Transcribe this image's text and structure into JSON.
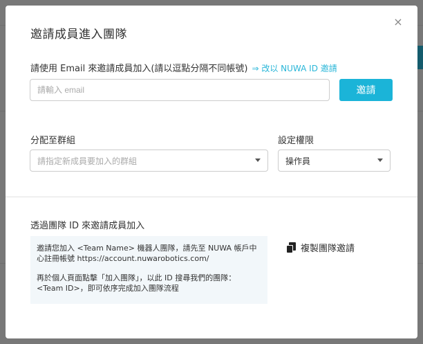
{
  "modal": {
    "title": "邀請成員進入團隊",
    "close_label": "×"
  },
  "email_section": {
    "label": "請使用 Email 來邀請成員加入(請以逗點分隔不同帳號)",
    "switch_link": "⇒ 改以 NUWA ID 邀請",
    "input_value": "",
    "input_placeholder": "請輸入 email",
    "invite_button": "邀請"
  },
  "group_section": {
    "label": "分配至群組",
    "placeholder": "請指定新成員要加入的群組"
  },
  "permission_section": {
    "label": "設定權限",
    "selected": "操作員"
  },
  "team_id_section": {
    "label": "透過團隊 ID 來邀請成員加入",
    "message_line1": "邀請您加入 <Team Name> 機器人團隊，請先至 NUWA 帳戶中心註冊帳號  https://account.nuwarobotics.com/",
    "message_line2": "再於個人頁面點擊「加入團隊」，以此 ID 搜尋我們的團隊：<Team ID>，即可依序完成加入團隊流程",
    "copy_button": "複製團隊邀請"
  },
  "colors": {
    "accent": "#1bb4d8",
    "info_bg": "#f2f7fa"
  },
  "icons": {
    "close": "close-icon",
    "caret": "chevron-down-icon",
    "copy": "copy-icon"
  }
}
